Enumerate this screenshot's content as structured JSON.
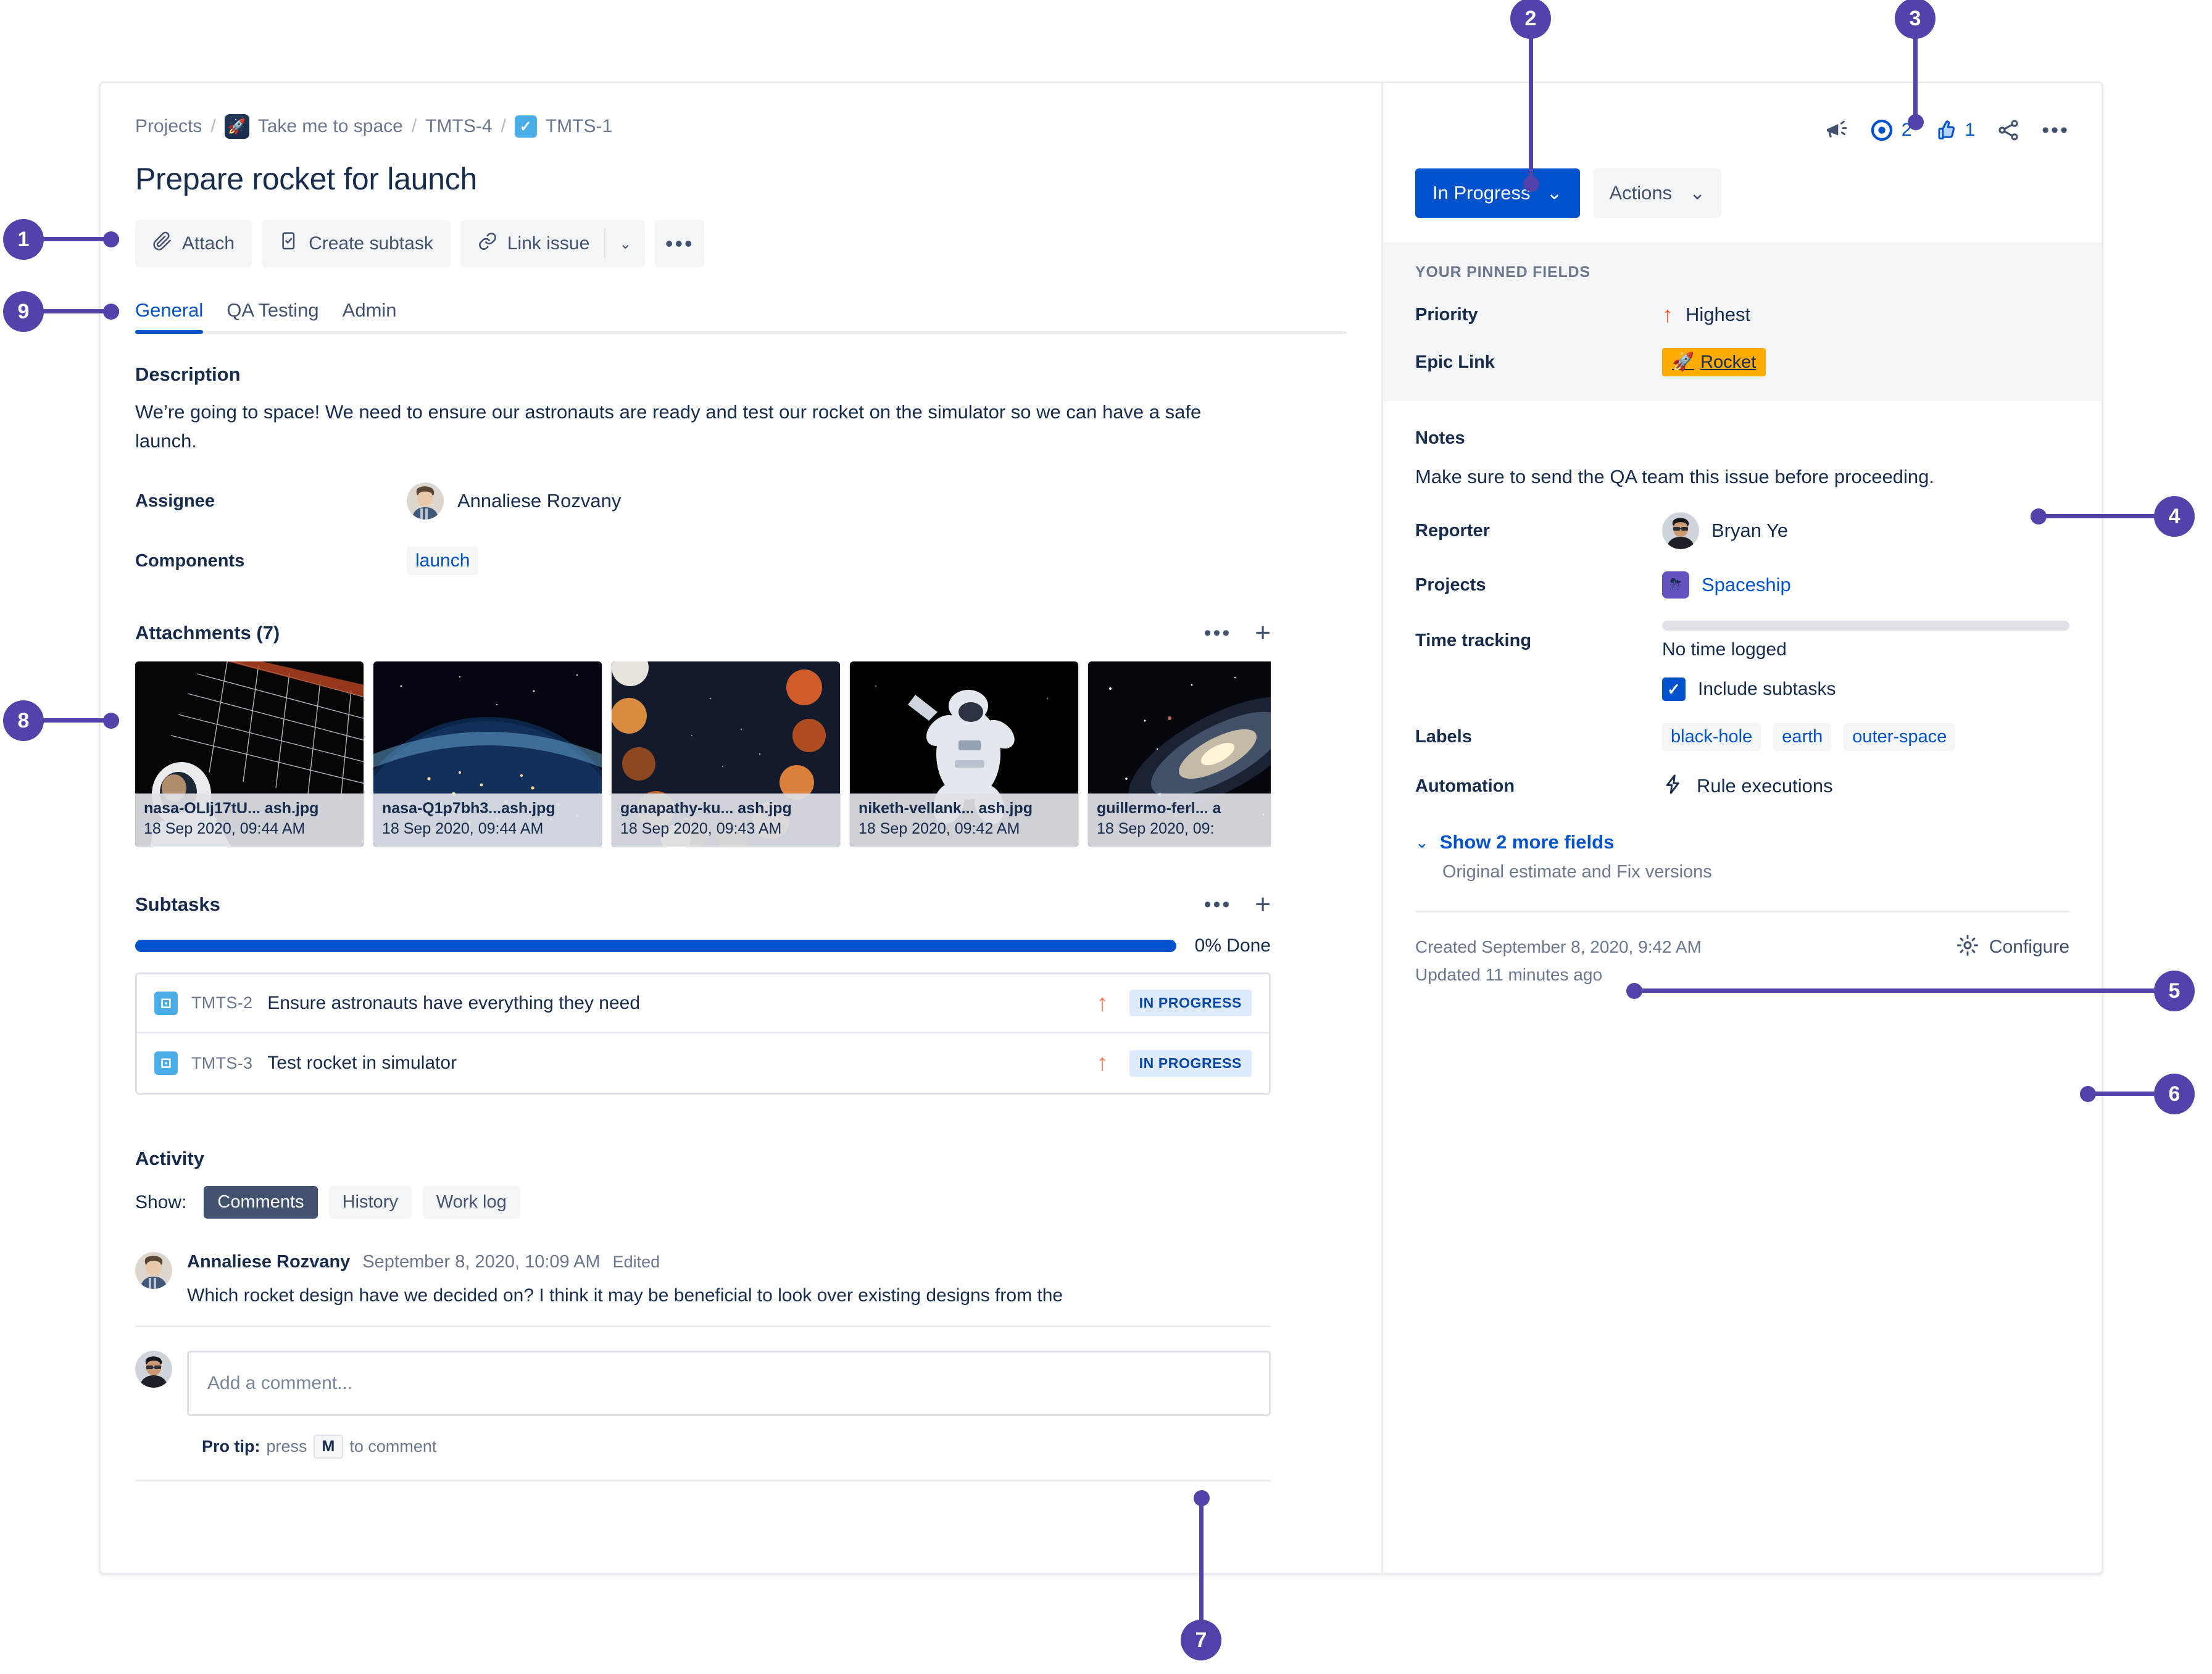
{
  "breadcrumb": {
    "projects": "Projects",
    "project_name": "Take me to space",
    "parent_key": "TMTS-4",
    "issue_key": "TMTS-1",
    "sep": "/"
  },
  "issue": {
    "title": "Prepare rocket for launch"
  },
  "actions": {
    "attach": "Attach",
    "create_subtask": "Create subtask",
    "link_issue": "Link issue",
    "more": "•••",
    "chevron": "⌄"
  },
  "tabs": [
    {
      "label": "General",
      "active": true
    },
    {
      "label": "QA Testing",
      "active": false
    },
    {
      "label": "Admin",
      "active": false
    }
  ],
  "description": {
    "heading": "Description",
    "text": "We’re going to space! We need to ensure our astronauts are ready and test our rocket on the simulator so we can have a safe launch."
  },
  "left_fields": {
    "assignee_label": "Assignee",
    "assignee_value": "Annaliese Rozvany",
    "components_label": "Components",
    "components_value": "launch"
  },
  "attachments": {
    "heading": "Attachments (7)",
    "items": [
      {
        "name": "nasa-OLIj17tU... ash.jpg",
        "date": "18 Sep 2020, 09:44 AM"
      },
      {
        "name": "nasa-Q1p7bh3...ash.jpg",
        "date": "18 Sep 2020, 09:44 AM"
      },
      {
        "name": "ganapathy-ku... ash.jpg",
        "date": "18 Sep 2020, 09:43 AM"
      },
      {
        "name": "niketh-vellank... ash.jpg",
        "date": "18 Sep 2020, 09:42 AM"
      },
      {
        "name": "guillermo-ferl...  a",
        "date": "18 Sep 2020, 09:"
      }
    ]
  },
  "subtasks": {
    "heading": "Subtasks",
    "progress_pct": 0,
    "progress_label": "0% Done",
    "rows": [
      {
        "key": "TMTS-2",
        "summary": "Ensure astronauts have everything they need",
        "status": "IN PROGRESS"
      },
      {
        "key": "TMTS-3",
        "summary": "Test rocket in simulator",
        "status": "IN PROGRESS"
      }
    ]
  },
  "activity": {
    "heading": "Activity",
    "show_label": "Show:",
    "segments": [
      {
        "label": "Comments",
        "active": true
      },
      {
        "label": "History",
        "active": false
      },
      {
        "label": "Work log",
        "active": false
      }
    ],
    "comment": {
      "author": "Annaliese Rozvany",
      "timestamp": "September 8, 2020, 10:09 AM",
      "edited": "Edited",
      "text": "Which rocket design have we decided on? I think it may be beneficial to look over existing designs from the"
    },
    "add_comment_placeholder": "Add a comment...",
    "protip_prefix": "Pro tip:",
    "protip_mid": "press",
    "protip_key": "M",
    "protip_suffix": "to comment"
  },
  "header_icons": {
    "feedback": "feedback-megaphone",
    "watch_count": "2",
    "like_count": "1",
    "share": "share",
    "more": "•••"
  },
  "status": {
    "current": "In Progress",
    "actions_label": "Actions"
  },
  "pinned": {
    "title": "YOUR PINNED FIELDS",
    "priority_label": "Priority",
    "priority_value": "Highest",
    "epic_label": "Epic Link",
    "epic_value": "Rocket"
  },
  "details": {
    "notes_label": "Notes",
    "notes_value": "Make sure to send the QA team this issue before proceeding.",
    "reporter_label": "Reporter",
    "reporter_value": "Bryan Ye",
    "projects_label": "Projects",
    "projects_value": "Spaceship",
    "time_tracking_label": "Time tracking",
    "time_tracking_value": "No time logged",
    "include_subtasks_label": "Include subtasks",
    "include_subtasks_checked": true,
    "labels_label": "Labels",
    "labels_values": [
      "black-hole",
      "earth",
      "outer-space"
    ],
    "automation_label": "Automation",
    "automation_value": "Rule executions",
    "show_more_label": "Show 2 more fields",
    "show_more_sub": "Original estimate and Fix versions",
    "created": "Created September 8, 2020, 9:42 AM",
    "updated": "Updated 11 minutes ago",
    "configure_label": "Configure"
  },
  "callouts": [
    {
      "n": "1"
    },
    {
      "n": "2"
    },
    {
      "n": "3"
    },
    {
      "n": "4"
    },
    {
      "n": "5"
    },
    {
      "n": "6"
    },
    {
      "n": "7"
    },
    {
      "n": "8"
    },
    {
      "n": "9"
    }
  ],
  "colors": {
    "callout_purple": "#5243AA",
    "primary_blue": "#0052cc",
    "status_in_progress_bg": "#deebff",
    "epic_yellow": "#ffab00",
    "priority_orange": "#ff5630"
  }
}
